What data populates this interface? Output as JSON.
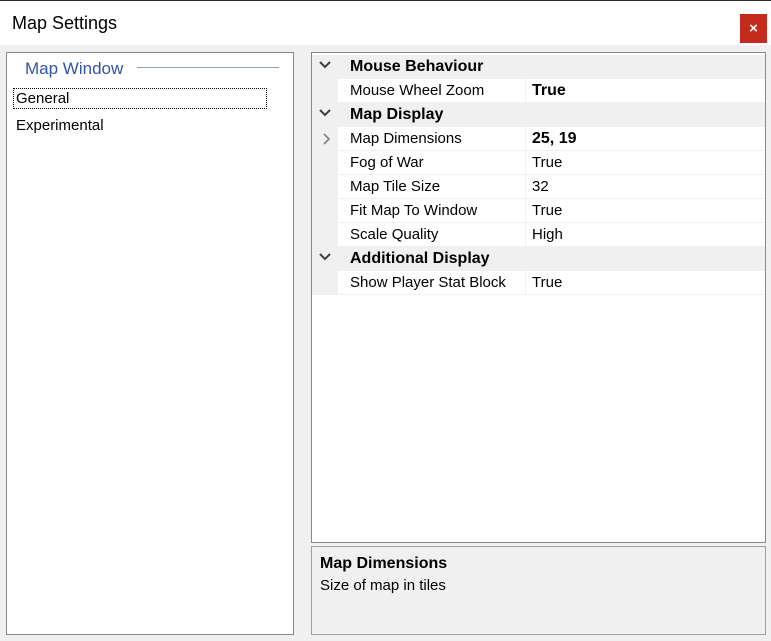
{
  "window": {
    "title": "Map Settings",
    "close_label": "×"
  },
  "left_panel": {
    "group_title": "Map Window",
    "items": [
      {
        "label": "General",
        "selected": true
      },
      {
        "label": "Experimental",
        "selected": false
      }
    ]
  },
  "property_grid": {
    "categories": [
      {
        "label": "Mouse Behaviour",
        "expanded": true
      },
      {
        "label": "Map Display",
        "expanded": true
      },
      {
        "label": "Additional Display",
        "expanded": true
      }
    ],
    "properties": [
      {
        "name": "Mouse Wheel Zoom",
        "value": "True",
        "bold": true
      },
      {
        "name": "Map Dimensions",
        "value": "25, 19",
        "bold": true,
        "expandable": true
      },
      {
        "name": "Fog of War",
        "value": "True"
      },
      {
        "name": "Map Tile Size",
        "value": "32"
      },
      {
        "name": "Fit Map To Window",
        "value": "True"
      },
      {
        "name": "Scale Quality",
        "value": "High"
      },
      {
        "name": "Show Player Stat Block",
        "value": "True"
      }
    ]
  },
  "description": {
    "title": "Map Dimensions",
    "text": "Size of map in tiles"
  },
  "colors": {
    "close_button": "#c42b1c",
    "group_title": "#3553a8",
    "window_bg": "#f0f0f0"
  },
  "icons": {
    "category_toggle": "chevron-down-icon",
    "property_expander": "chevron-right-icon"
  }
}
